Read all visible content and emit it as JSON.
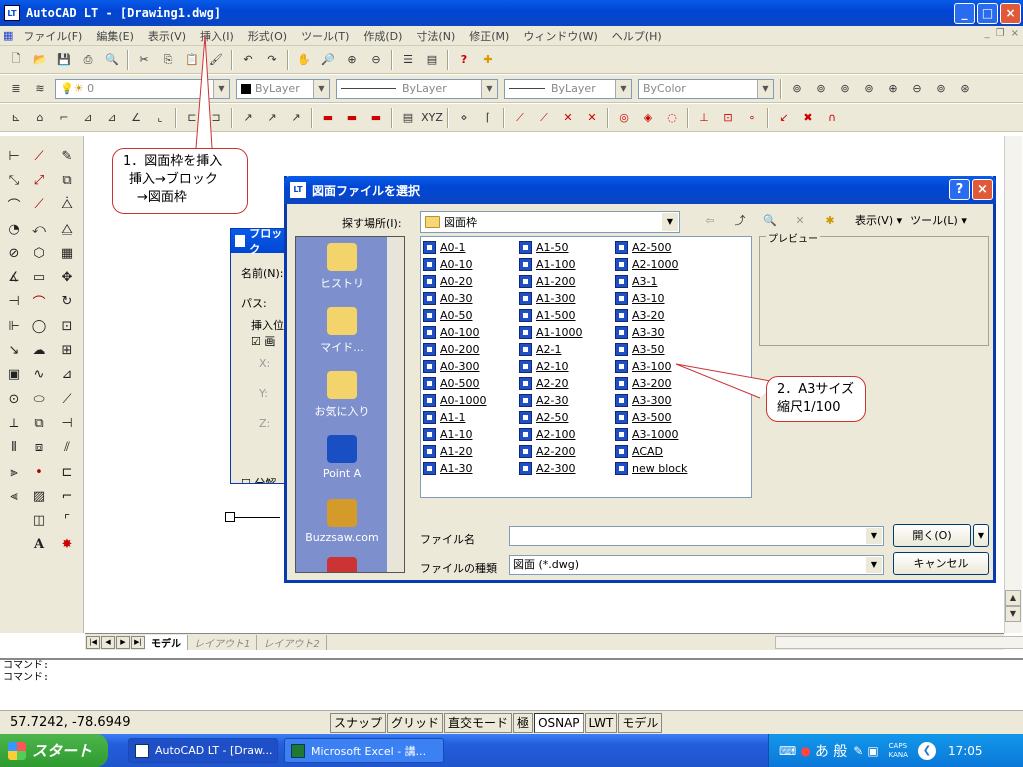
{
  "window": {
    "title": "AutoCAD LT - [Drawing1.dwg]",
    "app_icon": "LT"
  },
  "menu": [
    "ファイル(F)",
    "編集(E)",
    "表示(V)",
    "挿入(I)",
    "形式(O)",
    "ツール(T)",
    "作成(D)",
    "寸法(N)",
    "修正(M)",
    "ウィンドウ(W)",
    "ヘルプ(H)"
  ],
  "layer_toolbar": {
    "layer_value": "0",
    "color": "ByLayer",
    "linetype": "ByLayer",
    "lineweight": "ByLayer",
    "plotstyle": "ByColor"
  },
  "tabs": [
    "モデル",
    "レイアウト1",
    "レイアウト2"
  ],
  "command": {
    "line1": "コマンド:",
    "line2": "コマンド:"
  },
  "status": {
    "coords": "57.7242, -78.6949",
    "toggles": [
      "スナップ",
      "グリッド",
      "直交モード",
      "極",
      "OSNAP",
      "LWT",
      "モデル"
    ]
  },
  "taskbar": {
    "start": "スタート",
    "tasks": [
      "AutoCAD LT - [Draw...",
      "Microsoft Excel - 講..."
    ],
    "ime": "あ 般",
    "caps": "CAPS",
    "kana": "KANA",
    "clock": "17:05"
  },
  "block_dialog": {
    "title": "ブロック",
    "name_label": "名前(N):",
    "path_label": "パス:",
    "insert_label": "挿入位",
    "check_label": "画",
    "x": "X:",
    "y": "Y:",
    "z": "Z:",
    "explode": "分解"
  },
  "file_dialog": {
    "title": "図面ファイルを選択",
    "look_in_label": "探す場所(I):",
    "look_in_value": "図面枠",
    "views_label": "表示(V)",
    "tools_label": "ツール(L)",
    "preview_label": "プレビュー",
    "places": [
      "ヒストリ",
      "マイド...",
      "お気に入り",
      "Point A",
      "Buzzsaw.com"
    ],
    "files_col1": [
      "A0-1",
      "A0-10",
      "A0-20",
      "A0-30",
      "A0-50",
      "A0-100",
      "A0-200",
      "A0-300",
      "A0-500",
      "A0-1000",
      "A1-1",
      "A1-10",
      "A1-20",
      "A1-30"
    ],
    "files_col2": [
      "A1-50",
      "A1-100",
      "A1-200",
      "A1-300",
      "A1-500",
      "A1-1000",
      "A2-1",
      "A2-10",
      "A2-20",
      "A2-30",
      "A2-50",
      "A2-100",
      "A2-200",
      "A2-300"
    ],
    "files_col3": [
      "A2-500",
      "A2-1000",
      "A3-1",
      "A3-10",
      "A3-20",
      "A3-30",
      "A3-50",
      "A3-100",
      "A3-200",
      "A3-300",
      "A3-500",
      "A3-1000",
      "ACAD",
      "new block"
    ],
    "filename_label": "ファイル名",
    "filename_value": "",
    "filetype_label": "ファイルの種類",
    "filetype_value": "図面 (*.dwg)",
    "open_button": "開く(O)",
    "cancel_button": "キャンセル"
  },
  "callout1": {
    "line1": "1．図面枠を挿入",
    "line2": "挿入→ブロック",
    "line3": "→図面枠"
  },
  "callout2": {
    "line1": "2．A3サイズ",
    "line2": "縮尺1/100"
  }
}
